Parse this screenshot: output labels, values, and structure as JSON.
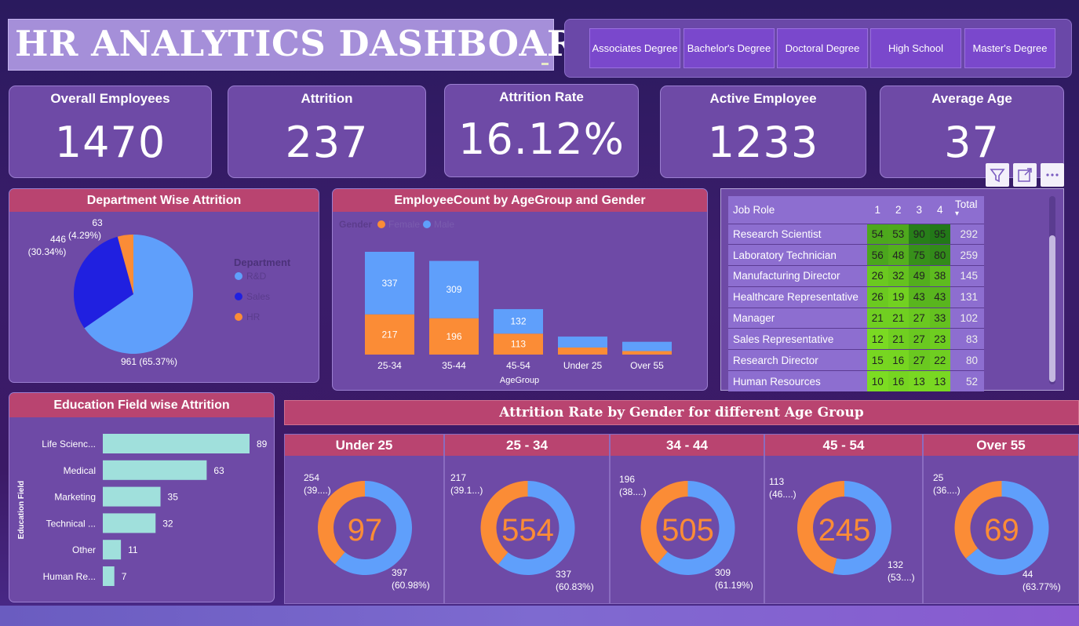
{
  "title": "HR ANALYTICS DASHBOARD",
  "slicer": {
    "options": [
      "Associates Degree",
      "Bachelor's Degree",
      "Doctoral Degree",
      "High School",
      "Master's Degree"
    ]
  },
  "kpis": [
    {
      "label": "Overall Employees",
      "value": "1470"
    },
    {
      "label": "Attrition",
      "value": "237"
    },
    {
      "label": "Attrition Rate",
      "value": "16.12%"
    },
    {
      "label": "Active Employee",
      "value": "1233"
    },
    {
      "label": "Average Age",
      "value": "37"
    }
  ],
  "colors": {
    "blue": "#5f9ffb",
    "orange": "#fb8c36",
    "dark_blue": "#2020e0",
    "teal": "#a0e0dc",
    "magenta": "#b94470"
  },
  "chart_data": [
    {
      "id": "department",
      "type": "pie",
      "title": "Department Wise Attrition",
      "legend_title": "Department",
      "slices": [
        {
          "name": "R&D",
          "value": 961,
          "label": "961 (65.37%)",
          "color": "#5f9ffb"
        },
        {
          "name": "Sales",
          "value": 446,
          "label": "446 (30.34%)",
          "color": "#2020e0"
        },
        {
          "name": "HR",
          "value": 63,
          "label": "63 (4.29%)",
          "color": "#fb8c36"
        }
      ]
    },
    {
      "id": "agegender",
      "type": "bar",
      "stacked": true,
      "title": "EmployeeCount by AgeGroup and Gender",
      "legend_title": "Gender",
      "xlabel": "AgeGroup",
      "categories": [
        "25-34",
        "35-44",
        "45-54",
        "Under 25",
        "Over 55"
      ],
      "series": [
        {
          "name": "Female",
          "values": [
            217,
            196,
            113,
            38,
            19
          ],
          "labels": [
            "217",
            "196",
            "113",
            "",
            ""
          ],
          "color": "#fb8c36"
        },
        {
          "name": "Male",
          "values": [
            337,
            309,
            132,
            59,
            50
          ],
          "labels": [
            "337",
            "309",
            "132",
            "",
            ""
          ],
          "color": "#5f9ffb"
        }
      ]
    },
    {
      "id": "jobrole",
      "type": "table",
      "columns": [
        "Job Role",
        "1",
        "2",
        "3",
        "4",
        "Total"
      ],
      "rows": [
        [
          "Research Scientist",
          54,
          53,
          90,
          95,
          292
        ],
        [
          "Laboratory Technician",
          56,
          48,
          75,
          80,
          259
        ],
        [
          "Manufacturing Director",
          26,
          32,
          49,
          38,
          145
        ],
        [
          "Healthcare Representative",
          26,
          19,
          43,
          43,
          131
        ],
        [
          "Manager",
          21,
          21,
          27,
          33,
          102
        ],
        [
          "Sales Representative",
          12,
          21,
          27,
          23,
          83
        ],
        [
          "Research Director",
          15,
          16,
          27,
          22,
          80
        ],
        [
          "Human Resources",
          10,
          16,
          13,
          13,
          52
        ]
      ]
    },
    {
      "id": "education",
      "type": "bar",
      "orientation": "horizontal",
      "title": "Education Field wise Attrition",
      "ylabel": "Education Field",
      "categories": [
        "Life Scienc...",
        "Medical",
        "Marketing",
        "Technical ...",
        "Other",
        "Human Re..."
      ],
      "values": [
        89,
        63,
        35,
        32,
        11,
        7
      ],
      "color": "#a0e0dc"
    },
    {
      "id": "donuts",
      "type": "pie",
      "title": "Attrition Rate by Gender for different Age Group",
      "donuts": [
        {
          "header": "Under 25",
          "center": "97",
          "female": 254,
          "male": 397,
          "female_label": [
            "254",
            "(39....)"
          ],
          "male_label": [
            "397",
            "(60.98%)"
          ]
        },
        {
          "header": "25 - 34",
          "center": "554",
          "female": 217,
          "male": 337,
          "female_label": [
            "217",
            "(39.1...)"
          ],
          "male_label": [
            "337",
            "(60.83%)"
          ]
        },
        {
          "header": "34 - 44",
          "center": "505",
          "female": 196,
          "male": 309,
          "female_label": [
            "196",
            "(38....)"
          ],
          "male_label": [
            "309",
            "(61.19%)"
          ]
        },
        {
          "header": "45 - 54",
          "center": "245",
          "female": 113,
          "male": 132,
          "female_label": [
            "113",
            "(46....)"
          ],
          "male_label": [
            "132",
            "(53....)"
          ]
        },
        {
          "header": "Over 55",
          "center": "69",
          "female": 25,
          "male": 44,
          "female_label": [
            "25",
            "(36....)"
          ],
          "male_label": [
            "44",
            "(63.77%)"
          ]
        }
      ]
    }
  ]
}
